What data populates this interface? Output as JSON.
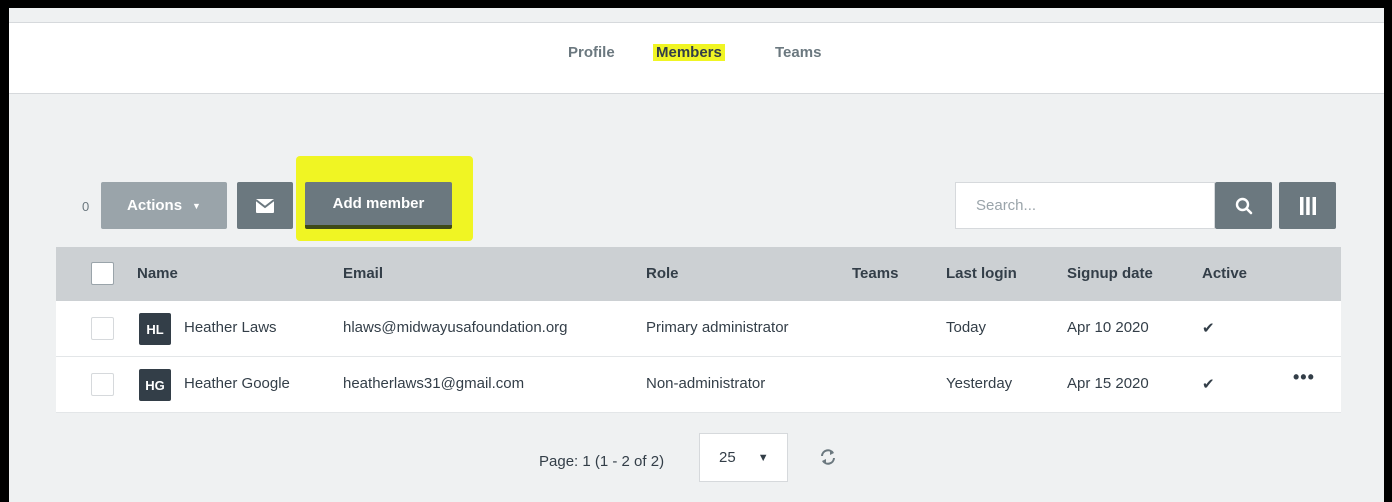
{
  "tabs": [
    {
      "label": "Profile"
    },
    {
      "label": "Members"
    },
    {
      "label": "Teams"
    }
  ],
  "toolbar": {
    "selected_count": "0",
    "actions_label": "Actions",
    "add_member_label": "Add member",
    "search_placeholder": "Search..."
  },
  "table": {
    "headers": {
      "name": "Name",
      "email": "Email",
      "role": "Role",
      "teams": "Teams",
      "last_login": "Last login",
      "signup_date": "Signup date",
      "active": "Active"
    },
    "rows": [
      {
        "initials": "HL",
        "name": "Heather Laws",
        "email": "hlaws@midwayusafoundation.org",
        "role": "Primary administrator",
        "teams": "",
        "last_login": "Today",
        "signup_date": "Apr 10 2020",
        "active": "✔"
      },
      {
        "initials": "HG",
        "name": "Heather Google",
        "email": "heatherlaws31@gmail.com",
        "role": "Non-administrator",
        "teams": "",
        "last_login": "Yesterday",
        "signup_date": "Apr 15 2020",
        "active": "✔",
        "more": "•••"
      }
    ]
  },
  "pagination": {
    "text": "Page: 1  (1 - 2 of 2)",
    "page_size": "25"
  },
  "colors": {
    "highlight": "#f0f523",
    "button": "#6b787f",
    "header_bg": "#ccd0d3"
  }
}
